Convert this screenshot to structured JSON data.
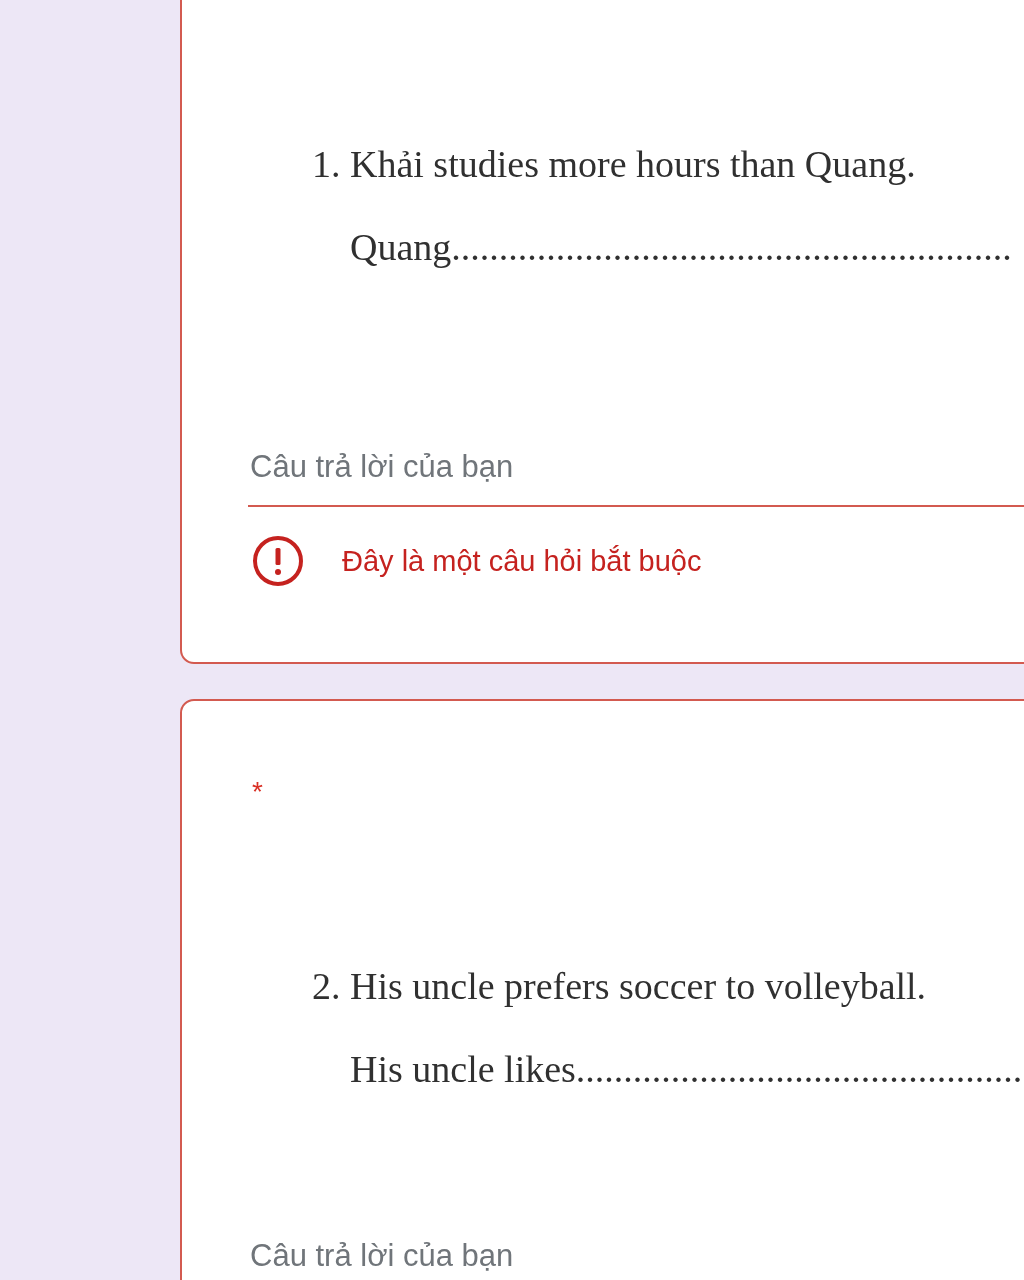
{
  "questions": [
    {
      "error": true,
      "lines": [
        "1. Khải studies more hours than Quang.",
        "Quang..........................................................."
      ],
      "answer": {
        "placeholder": "Câu trả lời của bạn"
      },
      "error_message": "Đây là một câu hỏi bắt buộc"
    },
    {
      "error": true,
      "required_mark": "*",
      "lines": [
        "2. His uncle prefers soccer to volleyball.",
        "His uncle likes..............................................."
      ],
      "answer": {
        "placeholder": "Câu trả lời của bạn"
      }
    }
  ]
}
